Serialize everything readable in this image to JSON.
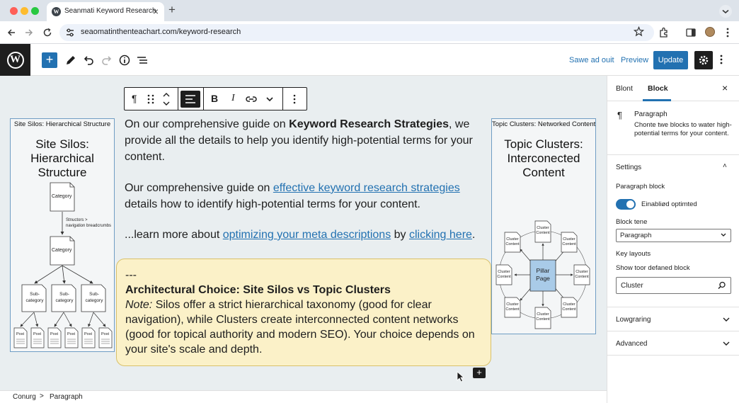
{
  "browser": {
    "tab_title": "Seanmati Keyword Research",
    "tab_close": "×",
    "new_tab": "+",
    "url": "seaomatinthenteachart.com/keyword-research"
  },
  "toolbar": {
    "inserter": "+",
    "save_draft_label": "Sawe ad ouit",
    "preview_label": "Preview",
    "update_label": "Update"
  },
  "block_toolbar": {
    "paragraph_icon": "¶",
    "bold": "B",
    "italic": "I"
  },
  "left_panel": {
    "caption": "Site Silos: Hierarchical Structure",
    "heading_line1": "Site Silos:",
    "heading_line2": "Hierarchical",
    "heading_line3": "Structure",
    "nodes": {
      "category": "Category",
      "sub": "Sub-",
      "category_word": "category",
      "post": "Post",
      "edge_label_1": "Stnuctors >",
      "edge_label_2": "navigation breadcrumbs"
    }
  },
  "right_panel": {
    "caption": "Topic Clusters: Networked Content",
    "heading_line1": "Topic Clusters:",
    "heading_line2": "Interconected",
    "heading_line3": "Content",
    "pillar_line1": "Pillar",
    "pillar_line2": "Page",
    "cluster_line1": "Cluster",
    "cluster_line2": "Content"
  },
  "content": {
    "p1_before": "On our comprehensive guide on ",
    "p1_bold": "Keyword Research Strategies",
    "p1_after": ", we provide all the details to help you identify high-potential terms for your content.",
    "p2_before": "Our comprehensive guide on ",
    "p2_link": "effective keyword research strategies",
    "p2_after": " details how to identify high-potential terms for your content.",
    "p3_before": "...learn more about ",
    "p3_link1": "optimizing your meta descriptions",
    "p3_mid": " by ",
    "p3_link2": "clicking here",
    "p3_after": ".",
    "note_divider": "---",
    "note_title": "Architectural Choice: Site Silos vs Topic Clusters",
    "note_label": "Note:",
    "note_body": " Silos offer a strict hierarchical taxonomy (good for clear navigation), while Clusters create interconnected content networks (good for topical authority and modern SEO). Your choice depends on your site's scale and depth."
  },
  "breadcrumb": {
    "item1": "Conurg",
    "separator": ">",
    "item2": "Paragraph"
  },
  "sidebar": {
    "tab_post": "Blont",
    "tab_block": "Block",
    "close": "×",
    "block_icon": "¶",
    "block_title": "Paragraph",
    "block_desc": "Chonte twe blocks to water high-potential terms for your content.",
    "settings_title": "Settings",
    "paragraph_block_label": "Paragraph block",
    "toggle_label": "Einabliød optimted",
    "block_tene_label": "Block tene",
    "block_tene_value": "Paragraph",
    "key_layouts_label": "Key layouts",
    "show_label": "Show toor defaned block",
    "search_value": "Cluster",
    "section_lowgraring": "Lowgraring",
    "section_advanced": "Advanced",
    "chevron_up": "˄",
    "chevron_down": "˅"
  },
  "colors": {
    "wp_blue": "#2271b1",
    "note_bg": "#fbf1c8",
    "canvas_bg": "#e9eef0",
    "pillar_bg": "#a9cbe8"
  }
}
